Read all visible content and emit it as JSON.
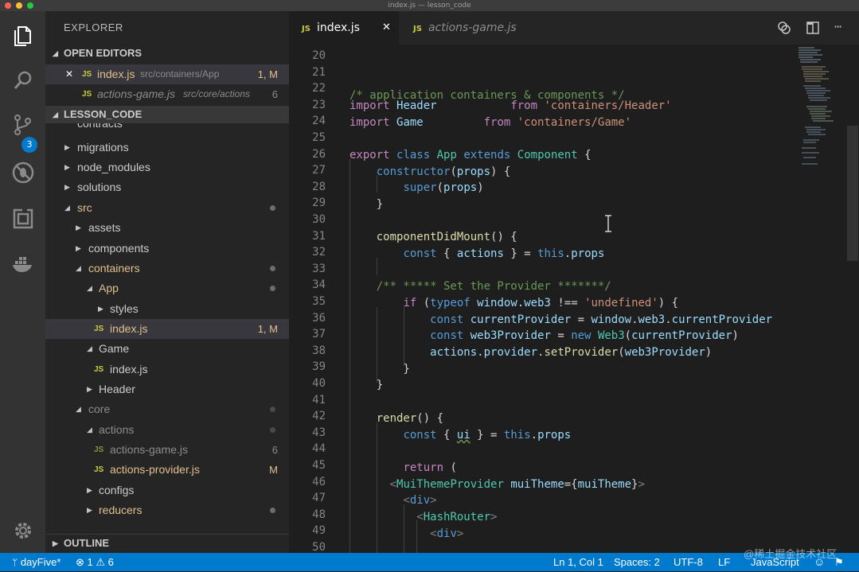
{
  "window": {
    "title": "index.js — lesson_code"
  },
  "sidebar": {
    "title": "EXPLORER",
    "open_editors": {
      "header": "OPEN EDITORS",
      "items": [
        {
          "close": "✕",
          "badge": "JS",
          "name": "index.js",
          "path": "src/containers/App",
          "status": "1, M"
        },
        {
          "badge": "JS",
          "name": "actions-game.js",
          "path": "src/core/actions",
          "status": "6"
        }
      ]
    },
    "workspace": {
      "header": "LESSON_CODE",
      "items": [
        {
          "name": "contracts"
        },
        {
          "name": "migrations"
        },
        {
          "name": "node_modules"
        },
        {
          "name": "solutions"
        },
        {
          "name": "src"
        },
        {
          "name": "assets"
        },
        {
          "name": "components"
        },
        {
          "name": "containers"
        },
        {
          "name": "App"
        },
        {
          "name": "styles"
        },
        {
          "name": "index.js",
          "badge": "JS",
          "status": "1, M"
        },
        {
          "name": "Game"
        },
        {
          "name": "index.js",
          "badge": "JS"
        },
        {
          "name": "Header"
        },
        {
          "name": "core"
        },
        {
          "name": "actions"
        },
        {
          "name": "actions-game.js",
          "badge": "JS",
          "status": "6"
        },
        {
          "name": "actions-provider.js",
          "badge": "JS",
          "status": "M"
        },
        {
          "name": "configs"
        },
        {
          "name": "reducers"
        }
      ]
    },
    "outline": {
      "header": "OUTLINE"
    }
  },
  "activity": {
    "scm_badge": "3"
  },
  "tabs": [
    {
      "badge": "JS",
      "name": "index.js",
      "close": "✕"
    },
    {
      "badge": "JS",
      "name": "actions-game.js"
    }
  ],
  "tab_actions": {
    "more": "···"
  },
  "editor": {
    "line_numbers": [
      "20",
      "21",
      "22",
      "23",
      "24",
      "25",
      "26",
      "27",
      "28",
      "29",
      "30",
      "31",
      "32",
      "33",
      "34",
      "35",
      "36",
      "37",
      "38",
      "39",
      "40",
      "41",
      "42",
      "43",
      "44",
      "45",
      "46",
      "47",
      "48",
      "49",
      "50"
    ]
  },
  "status_bar": {
    "branch": "dayFive*",
    "errors": "1",
    "warnings": "6",
    "cursor": "Ln 1, Col 1",
    "spaces": "Spaces: 2",
    "encoding": "UTF-8",
    "eol": "LF",
    "language": "JavaScript",
    "watermark": "@稀土掘金技术社区"
  },
  "colors": {
    "status_bar": "#007acc",
    "sidebar": "#252526",
    "editor": "#1e1e1e",
    "modified": "#e2c08d",
    "js_badge": "#cbcb41"
  }
}
